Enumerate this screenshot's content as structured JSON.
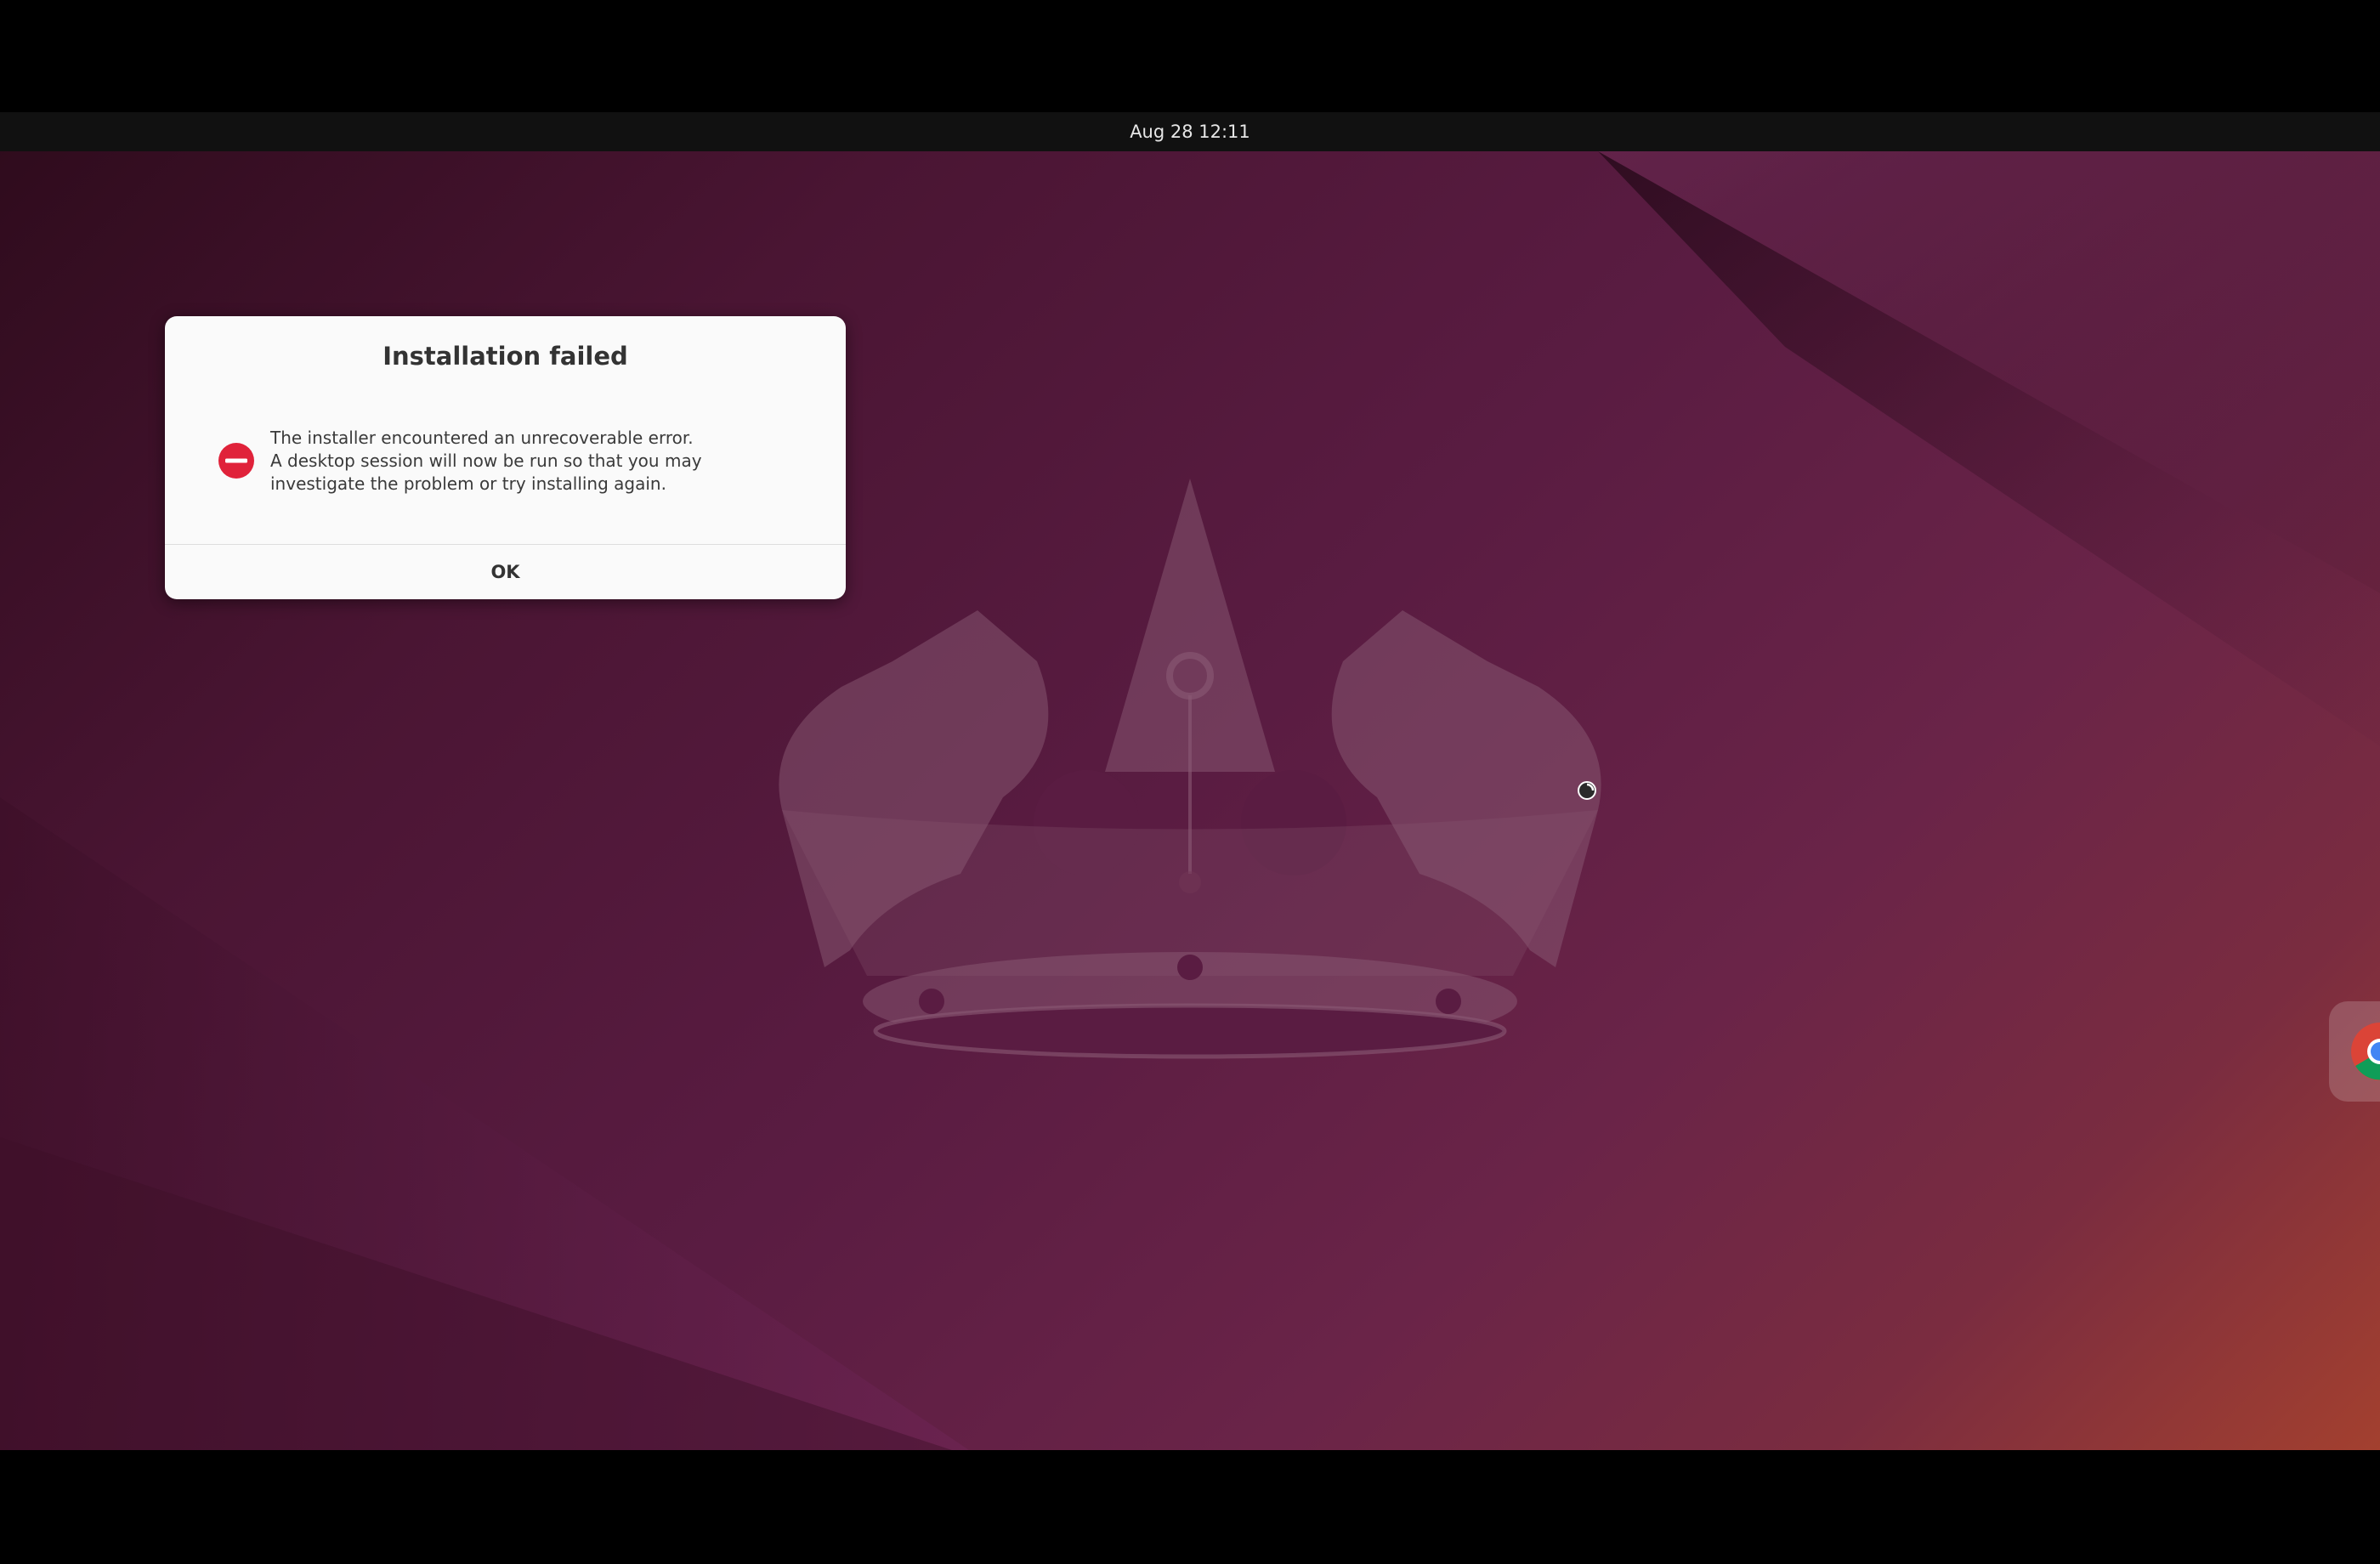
{
  "topbar": {
    "clock": "Aug 28  12:11"
  },
  "dialog": {
    "title": "Installation failed",
    "message_lines": [
      "The installer encountered an unrecoverable error.",
      "A desktop session will now be run so that you may",
      "investigate the problem or try installing again."
    ],
    "ok_label": "OK",
    "icon": "error-icon",
    "icon_color": "#e0223a"
  },
  "dock": {
    "partial_app_icon": "chrome-icon"
  },
  "colors": {
    "topbar": "#111111",
    "dialog_bg": "#fafafa",
    "wallpaper_accent": "#5a1c42"
  }
}
